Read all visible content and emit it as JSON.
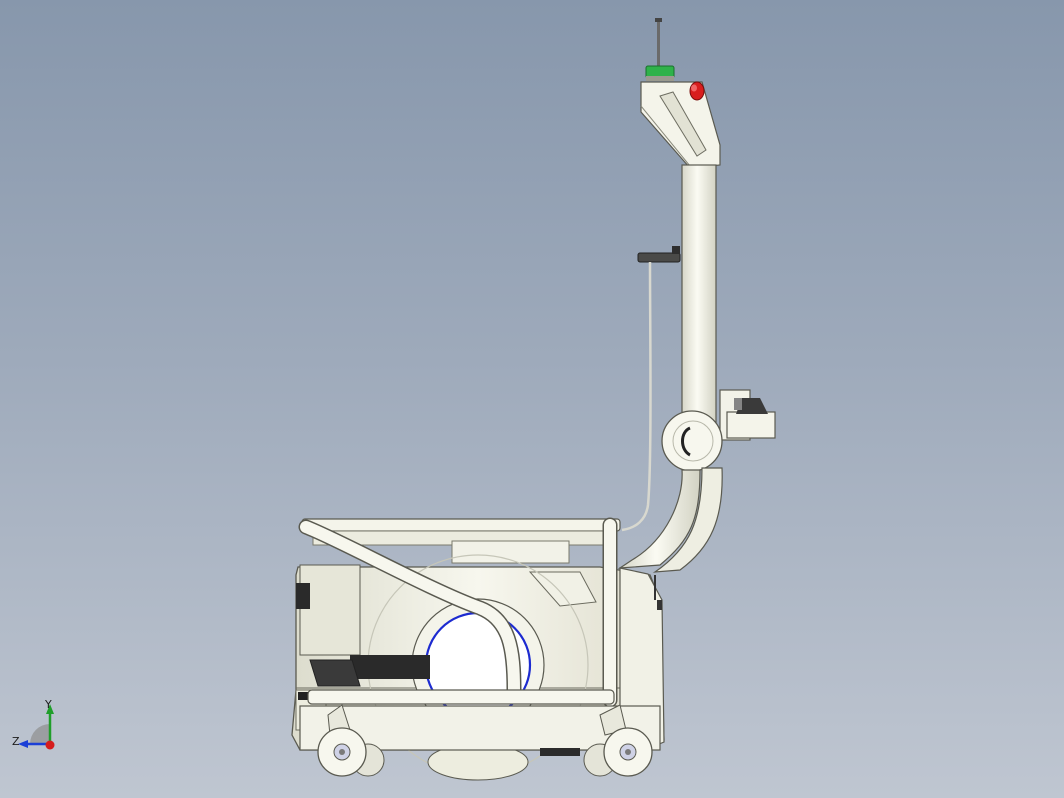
{
  "viewport": {
    "background_top": "#8797ac",
    "background_bottom": "#bfc6d1"
  },
  "model": {
    "body_color": "#f1f1e6",
    "edge_color": "#5a5a50",
    "indicator_green": "#2fb24a",
    "estop_red": "#d81e1e",
    "accent_blue": "#1d2bd0"
  },
  "triad": {
    "y_label": "Y",
    "z_label": "Z",
    "y_color": "#1f9e2a",
    "z_color": "#1b3fd6",
    "x_color": "#d51c1c"
  }
}
